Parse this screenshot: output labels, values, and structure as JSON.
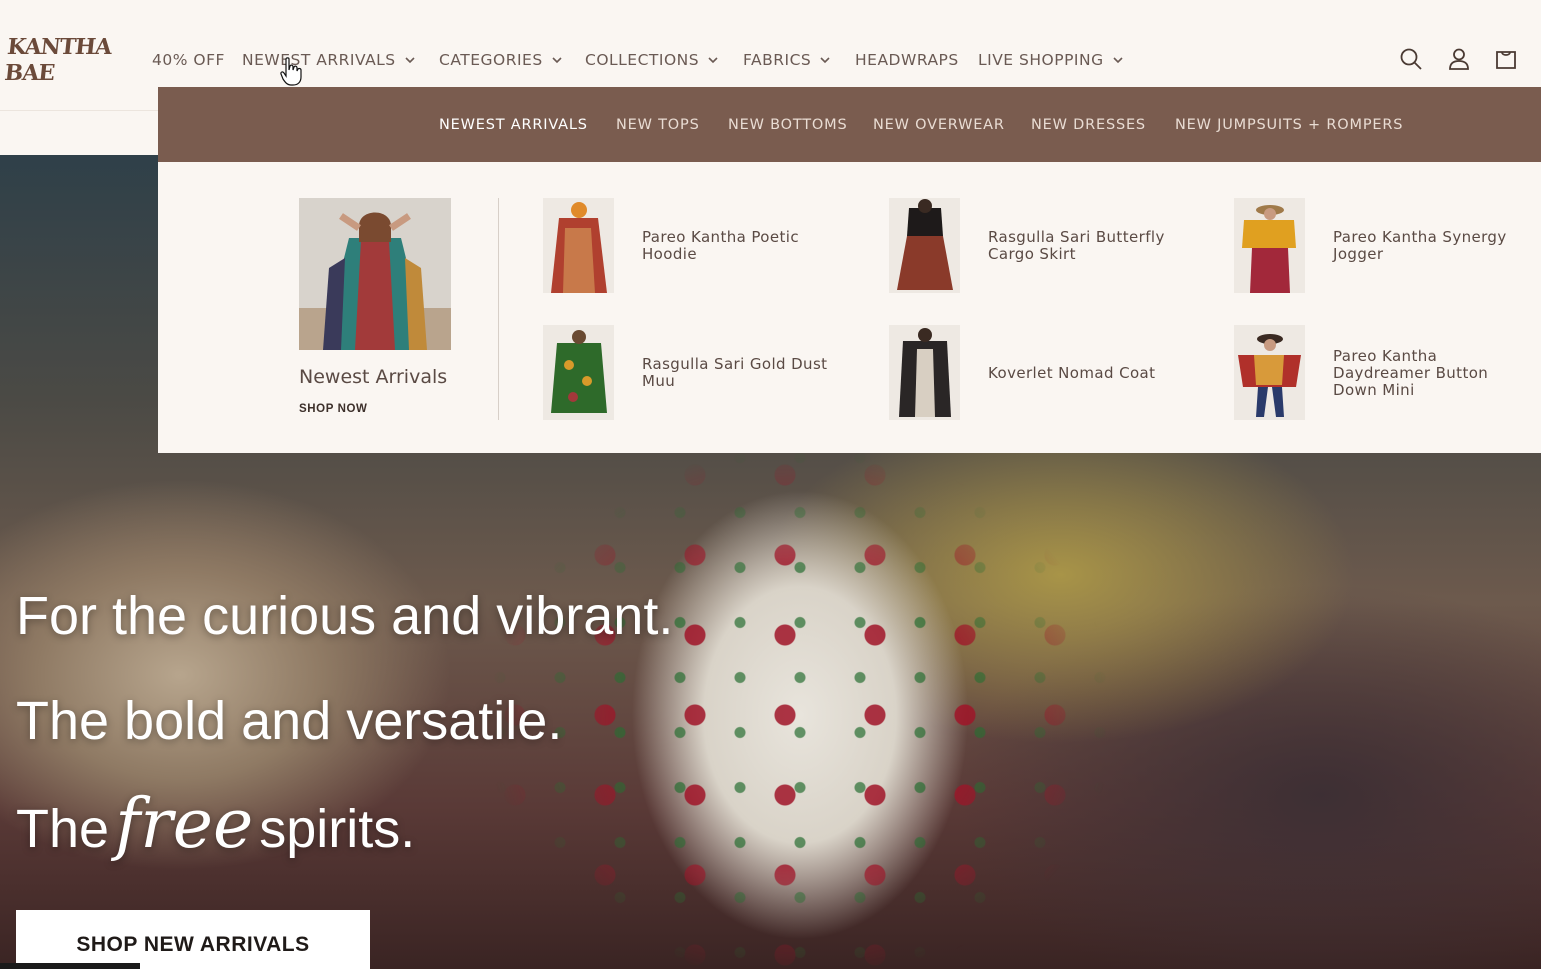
{
  "header": {
    "logo_text": "KANTHA BAE",
    "nav": [
      {
        "label": "40% OFF",
        "has_dropdown": false
      },
      {
        "label": "NEWEST ARRIVALS",
        "has_dropdown": true
      },
      {
        "label": "CATEGORIES",
        "has_dropdown": true
      },
      {
        "label": "COLLECTIONS",
        "has_dropdown": true
      },
      {
        "label": "FABRICS",
        "has_dropdown": true
      },
      {
        "label": "HEADWRAPS",
        "has_dropdown": false
      },
      {
        "label": "LIVE SHOPPING",
        "has_dropdown": true
      }
    ],
    "icons": [
      "search-icon",
      "account-icon",
      "cart-icon"
    ]
  },
  "mega_menu": {
    "tabs": [
      {
        "label": "NEWEST ARRIVALS",
        "active": true
      },
      {
        "label": "NEW TOPS",
        "active": false
      },
      {
        "label": "NEW BOTTOMS",
        "active": false
      },
      {
        "label": "NEW OVERWEAR",
        "active": false
      },
      {
        "label": "NEW DRESSES",
        "active": false
      },
      {
        "label": "NEW JUMPSUITS + ROMPERS",
        "active": false
      }
    ],
    "feature": {
      "title": "Newest Arrivals",
      "link": "SHOP NOW"
    },
    "products": [
      {
        "name": "Pareo Kantha Poetic Hoodie"
      },
      {
        "name": "Rasgulla Sari Butterfly Cargo Skirt"
      },
      {
        "name": "Pareo Kantha Synergy Jogger"
      },
      {
        "name": "Rasgulla Sari Gold Dust Muu"
      },
      {
        "name": "Koverlet Nomad Coat"
      },
      {
        "name": "Pareo Kantha Daydreamer Button Down Mini"
      }
    ]
  },
  "hero": {
    "line1": "For the curious and vibrant.",
    "line2": "The bold and versatile.",
    "line3_before": "The",
    "line3_script": "free",
    "line3_after": "spirits.",
    "button": "SHOP NEW ARRIVALS"
  },
  "colors": {
    "menu_bar": "#7a5c4f",
    "background": "#faf6f2",
    "text": "#5a4a44"
  }
}
